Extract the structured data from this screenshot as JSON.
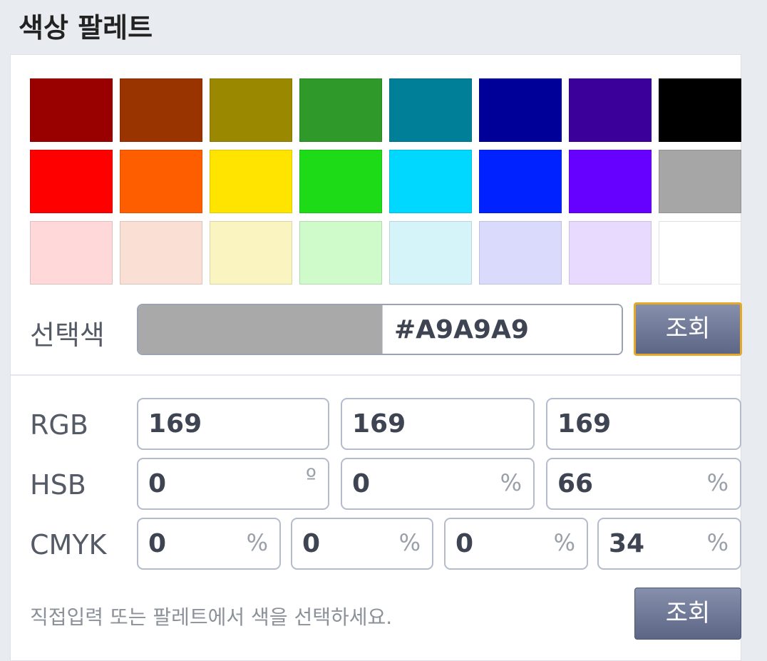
{
  "title": "색상 팔레트",
  "palette": [
    "#990000",
    "#993300",
    "#998800",
    "#2f992a",
    "#007f99",
    "#000099",
    "#3a0099",
    "#000000",
    "#ff0000",
    "#ff5e00",
    "#ffe400",
    "#1ddb16",
    "#00d8ff",
    "#0022ff",
    "#6600ff",
    "#a6a6a6",
    "#ffd9d9",
    "#fae0d4",
    "#faf4c0",
    "#cefbc9",
    "#d4f4fa",
    "#dadafd",
    "#e8d9ff",
    "#ffffff"
  ],
  "selected": {
    "label": "선택색",
    "color": "#a9a9a9",
    "hex": "#A9A9A9",
    "button": "조회"
  },
  "rgb": {
    "label": "RGB",
    "r": "169",
    "g": "169",
    "b": "169"
  },
  "hsb": {
    "label": "HSB",
    "h": "0",
    "s": "0",
    "b": "66",
    "h_unit": "º",
    "s_unit": "%",
    "b_unit": "%"
  },
  "cmyk": {
    "label": "CMYK",
    "c": "0",
    "m": "0",
    "y": "0",
    "k": "34",
    "unit": "%"
  },
  "footer": {
    "hint": "직접입력 또는 팔레트에서 색을 선택하세요.",
    "button": "조회"
  }
}
